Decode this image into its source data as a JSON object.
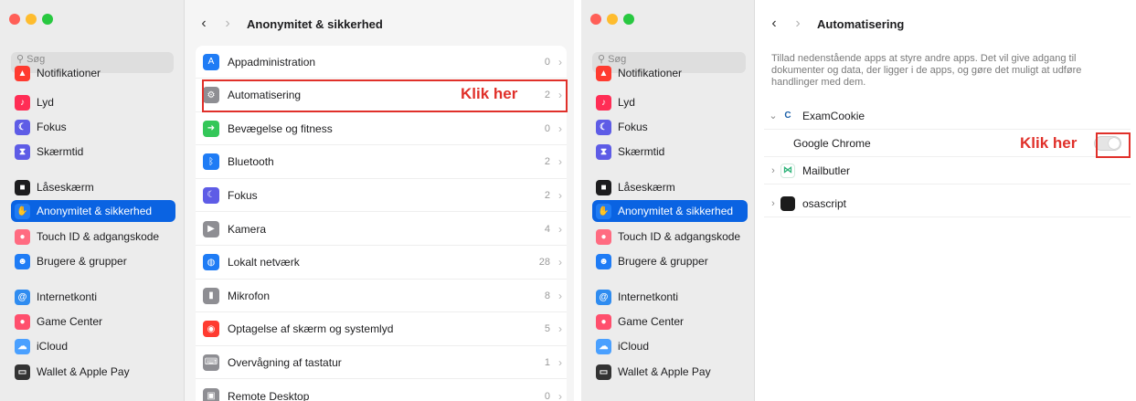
{
  "left": {
    "search_placeholder": "Søg",
    "header_title": "Anonymitet & sikkerhed",
    "sidebar": [
      {
        "label": "Notifikationer",
        "icon": "bell-icon",
        "color": "#ff3b30"
      },
      {
        "label": "Lyd",
        "icon": "speaker-icon",
        "color": "#ff2d55"
      },
      {
        "label": "Fokus",
        "icon": "moon-icon",
        "color": "#5e5ce6"
      },
      {
        "label": "Skærmtid",
        "icon": "hourglass-icon",
        "color": "#5e5ce6"
      },
      {
        "label": "Låseskærm",
        "icon": "lock-icon",
        "color": "#1d1d1f"
      },
      {
        "label": "Anonymitet & sikkerhed",
        "icon": "hand-icon",
        "color": "#1f7cf5",
        "selected": true
      },
      {
        "label": "Touch ID & adgangskode",
        "icon": "fingerprint-icon",
        "color": "#ff6b81"
      },
      {
        "label": "Brugere & grupper",
        "icon": "users-icon",
        "color": "#1f7cf5"
      },
      {
        "label": "Internetkonti",
        "icon": "at-icon",
        "color": "#2f8cf0"
      },
      {
        "label": "Game Center",
        "icon": "game-center-icon",
        "color": "#ff4f6d"
      },
      {
        "label": "iCloud",
        "icon": "cloud-icon",
        "color": "#4aa0ff"
      },
      {
        "label": "Wallet & Apple Pay",
        "icon": "wallet-icon",
        "color": "#333333"
      }
    ],
    "rows": [
      {
        "label": "Appadministration",
        "count": "0",
        "icon": "appstore-icon",
        "color": "#1f7cf5"
      },
      {
        "label": "Automatisering",
        "count": "2",
        "icon": "gears-icon",
        "color": "#8e8e93"
      },
      {
        "label": "Bevægelse og fitness",
        "count": "0",
        "icon": "runner-icon",
        "color": "#34c759"
      },
      {
        "label": "Bluetooth",
        "count": "2",
        "icon": "bluetooth-icon",
        "color": "#1f7cf5"
      },
      {
        "label": "Fokus",
        "count": "2",
        "icon": "moon-icon",
        "color": "#5e5ce6"
      },
      {
        "label": "Kamera",
        "count": "4",
        "icon": "camera-icon",
        "color": "#8e8e93"
      },
      {
        "label": "Lokalt netværk",
        "count": "28",
        "icon": "globe-icon",
        "color": "#1f7cf5"
      },
      {
        "label": "Mikrofon",
        "count": "8",
        "icon": "mic-icon",
        "color": "#8e8e93"
      },
      {
        "label": "Optagelse af skærm og systemlyd",
        "count": "5",
        "icon": "record-icon",
        "color": "#ff3b30"
      },
      {
        "label": "Overvågning af tastatur",
        "count": "1",
        "icon": "keyboard-icon",
        "color": "#8e8e93"
      },
      {
        "label": "Remote Desktop",
        "count": "0",
        "icon": "remote-desktop-icon",
        "color": "#8e8e93"
      }
    ],
    "callout": "Klik her"
  },
  "right": {
    "search_placeholder": "Søg",
    "header_title": "Automatisering",
    "description": "Tillad nedenstående apps at styre andre apps. Det vil give adgang til dokumenter og data, der ligger i de apps, og gøre det muligt at udføre handlinger med dem.",
    "sidebar": [
      {
        "label": "Notifikationer",
        "icon": "bell-icon",
        "color": "#ff3b30"
      },
      {
        "label": "Lyd",
        "icon": "speaker-icon",
        "color": "#ff2d55"
      },
      {
        "label": "Fokus",
        "icon": "moon-icon",
        "color": "#5e5ce6"
      },
      {
        "label": "Skærmtid",
        "icon": "hourglass-icon",
        "color": "#5e5ce6"
      },
      {
        "label": "Låseskærm",
        "icon": "lock-icon",
        "color": "#1d1d1f"
      },
      {
        "label": "Anonymitet & sikkerhed",
        "icon": "hand-icon",
        "color": "#1f7cf5",
        "selected": true
      },
      {
        "label": "Touch ID & adgangskode",
        "icon": "fingerprint-icon",
        "color": "#ff6b81"
      },
      {
        "label": "Brugere & grupper",
        "icon": "users-icon",
        "color": "#1f7cf5"
      },
      {
        "label": "Internetkonti",
        "icon": "at-icon",
        "color": "#2f8cf0"
      },
      {
        "label": "Game Center",
        "icon": "game-center-icon",
        "color": "#ff4f6d"
      },
      {
        "label": "iCloud",
        "icon": "cloud-icon",
        "color": "#4aa0ff"
      },
      {
        "label": "Wallet & Apple Pay",
        "icon": "wallet-icon",
        "color": "#333333"
      }
    ],
    "apps": [
      {
        "label": "ExamCookie",
        "icon": "examcookie-icon",
        "expanded": true
      },
      {
        "label": "Google Chrome",
        "child": true,
        "toggle_on": false
      },
      {
        "label": "Mailbutler",
        "icon": "mailbutler-icon",
        "expanded": false
      },
      {
        "label": "osascript",
        "icon": "terminal-icon",
        "expanded": false
      }
    ],
    "callout": "Klik her"
  },
  "colors": {
    "accent": "#0a63e2",
    "callout_red": "#e0302a"
  }
}
